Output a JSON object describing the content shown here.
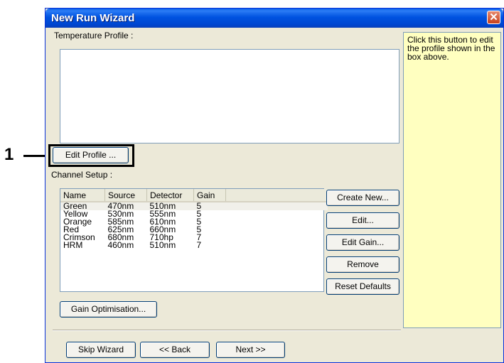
{
  "callout": {
    "number": "1"
  },
  "window": {
    "title": "New Run Wizard",
    "close_glyph": "✕"
  },
  "temperature_profile": {
    "label": "Temperature Profile :",
    "edit_button": "Edit Profile ..."
  },
  "channel_setup": {
    "label": "Channel Setup :",
    "columns": [
      "Name",
      "Source",
      "Detector",
      "Gain"
    ],
    "rows": [
      {
        "name": "Green",
        "source": "470nm",
        "detector": "510nm",
        "gain": "5"
      },
      {
        "name": "Yellow",
        "source": "530nm",
        "detector": "555nm",
        "gain": "5"
      },
      {
        "name": "Orange",
        "source": "585nm",
        "detector": "610nm",
        "gain": "5"
      },
      {
        "name": "Red",
        "source": "625nm",
        "detector": "660nm",
        "gain": "5"
      },
      {
        "name": "Crimson",
        "source": "680nm",
        "detector": "710hp",
        "gain": "7"
      },
      {
        "name": "HRM",
        "source": "460nm",
        "detector": "510nm",
        "gain": "7"
      }
    ],
    "buttons": {
      "create_new": "Create New...",
      "edit": "Edit...",
      "edit_gain": "Edit Gain...",
      "remove": "Remove",
      "reset_defaults": "Reset Defaults"
    },
    "gain_optimisation": "Gain Optimisation..."
  },
  "help": {
    "text": "Click this button to edit the profile shown in the box above."
  },
  "footer": {
    "skip": "Skip Wizard",
    "back": "<< Back",
    "next": "Next >>"
  },
  "colors": {
    "titlebar": "#0054e3",
    "dialog": "#ece9d8",
    "help_bg": "#ffffc0",
    "close": "#d9542b"
  }
}
